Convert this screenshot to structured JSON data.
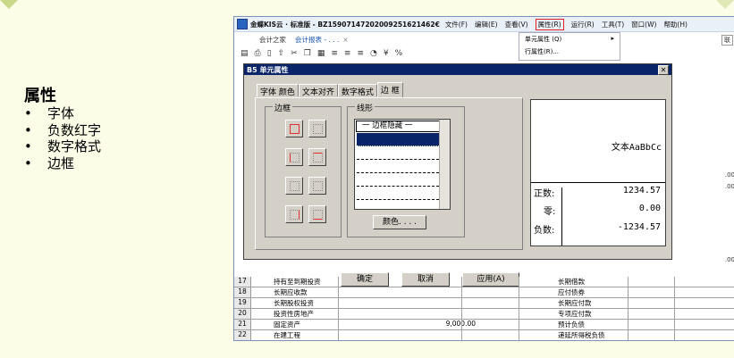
{
  "slide": {
    "title": "属性",
    "bullets": [
      "字体",
      "负数红字",
      "数字格式",
      "边框"
    ],
    "bullet_glyph": "•"
  },
  "window": {
    "title": "金蝶KIS云 · 标准版 - BZ15907147202009251621462€",
    "menus": [
      "文件(F)",
      "编辑(E)",
      "查看(V)",
      "属性(R)",
      "运行(R)",
      "工具(T)",
      "窗口(W)",
      "帮助(H)"
    ],
    "active_menu": "属性(R)"
  },
  "tabs": {
    "home": "会计之家",
    "report": "会计报表 - . . .",
    "close": "×"
  },
  "side_button": "联",
  "attr_menu": {
    "item1": "单元属性 (Q)",
    "item1_arrow": "▸",
    "item2": "行属性(R)..."
  },
  "dialog": {
    "title": "B5 单元属性",
    "close": "✕",
    "tabs": [
      "字体 颜色",
      "文本对齐",
      "数字格式",
      "边 框"
    ],
    "border_group": "边框",
    "linestyle_group": "线形",
    "linestyle_header": "一 边框隐藏 一",
    "color_button": "颜色. . . .",
    "ok": "确定",
    "cancel": "取消",
    "apply": "应用(A)"
  },
  "preview": {
    "sample": "文本AaBbCc",
    "rows": [
      {
        "k": "正数:",
        "v": "1234.57"
      },
      {
        "k": "零:",
        "v": "0.00"
      },
      {
        "k": "负数:",
        "v": "-1234.57"
      }
    ]
  },
  "sheet": {
    "rows": [
      {
        "n": "17",
        "a": "持有至到期投资",
        "b": "",
        "c": "长期借款"
      },
      {
        "n": "18",
        "a": "长期应收款",
        "b": "",
        "c": "应付债券"
      },
      {
        "n": "19",
        "a": "长期股权投资",
        "b": "",
        "c": "长期应付款"
      },
      {
        "n": "20",
        "a": "投资性房地产",
        "b": "",
        "c": "专项应付款"
      },
      {
        "n": "21",
        "a": "固定资产",
        "b": "9,000.00",
        "c": "预计负债"
      },
      {
        "n": "22",
        "a": "在建工程",
        "b": "",
        "c": "递延所得税负债"
      }
    ],
    "edge_values": [
      ".00",
      ".00",
      ".00"
    ]
  }
}
